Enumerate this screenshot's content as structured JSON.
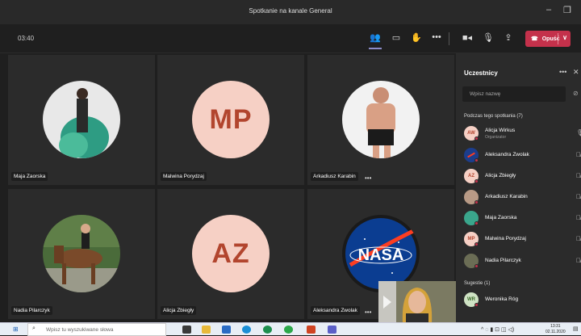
{
  "window": {
    "title": "Spotkanie na kanale General"
  },
  "toolbar": {
    "timer": "03:40",
    "leave_label": "Opuść"
  },
  "tiles": [
    {
      "name": "Maja Zaorska",
      "initials": ""
    },
    {
      "name": "Malwina Porydzaj",
      "initials": "MP"
    },
    {
      "name": "Arkadiusz Karabin",
      "initials": ""
    },
    {
      "name": "Nadia Pilarczyk",
      "initials": ""
    },
    {
      "name": "Alicja Zbiegły",
      "initials": "AZ"
    },
    {
      "name": "Aleksandra Zwolak",
      "initials": ""
    }
  ],
  "nasa_label": "NASA",
  "panel": {
    "title": "Uczestnicy",
    "search_placeholder": "Wpisz nazwę",
    "section_meeting": "Podczas tego spotkania (7)",
    "section_suggest": "Sugestie (1)",
    "participants": [
      {
        "name": "Alicja Wirkus",
        "role": "Organizator",
        "initials": "AW",
        "color": "#f6d0c5"
      },
      {
        "name": "Aleksandra Zwolak",
        "role": "",
        "initials": "",
        "color": "#1c3d8c"
      },
      {
        "name": "Alicja Zbiegły",
        "role": "",
        "initials": "AZ",
        "color": "#f6d0c5"
      },
      {
        "name": "Arkadiusz Karabin",
        "role": "",
        "initials": "",
        "color": "#b89a86"
      },
      {
        "name": "Maja Zaorska",
        "role": "",
        "initials": "",
        "color": "#3aa68c"
      },
      {
        "name": "Malwina Porydzaj",
        "role": "",
        "initials": "MP",
        "color": "#f6d0c5"
      },
      {
        "name": "Nadia Pilarczyk",
        "role": "",
        "initials": "",
        "color": "#6b6d55"
      }
    ],
    "suggestions": [
      {
        "name": "Weronika Róg",
        "initials": "WR",
        "color": "#cfe3c4"
      }
    ]
  },
  "taskbar": {
    "search_placeholder": "Wpisz tu wyszukiwane słowa",
    "time": "13:31",
    "date": "02.11.2020"
  },
  "colors": {
    "leave": "#c4314b",
    "avatar_bg": "#f6d0c5",
    "avatar_text": "#b2452e",
    "panel_bg": "#2b2b2b"
  }
}
